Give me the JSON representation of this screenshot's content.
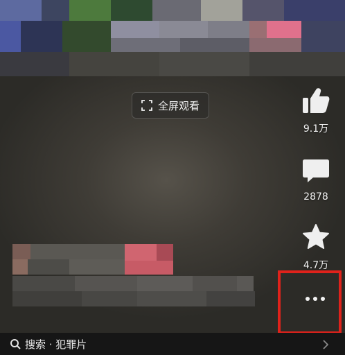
{
  "video": {
    "fullscreen_label": "全屏观看"
  },
  "actions": {
    "like_count": "9.1万",
    "comment_count": "2878",
    "favorite_count": "4.7万"
  },
  "search_bar": {
    "text": "搜索 · 犯罪片"
  },
  "colors": {
    "highlight_border": "#e0221b"
  },
  "icons": [
    "thumbs-up-icon",
    "comment-icon",
    "star-icon",
    "more-icon",
    "search-icon",
    "chevron-right-icon",
    "fullscreen-icon"
  ]
}
